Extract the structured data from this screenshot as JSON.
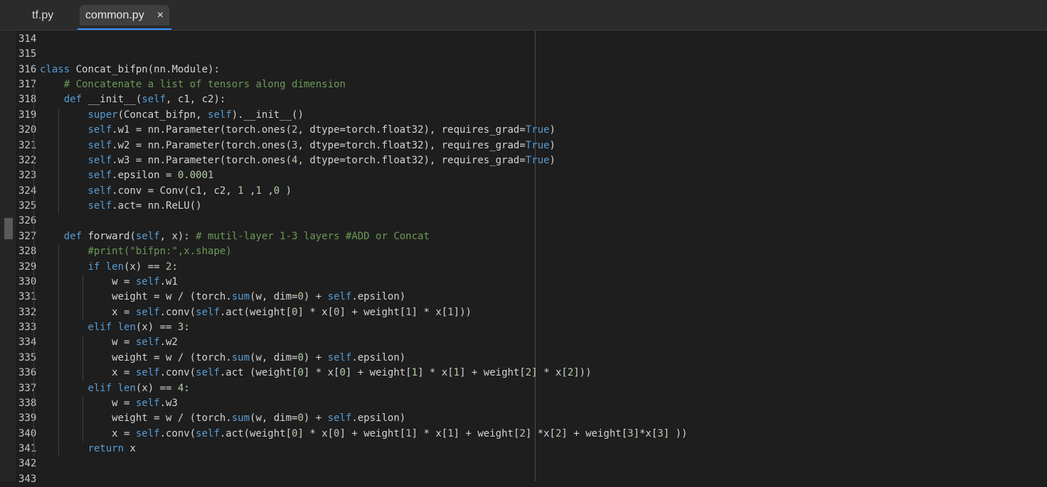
{
  "tabs": [
    {
      "label": "tf.py"
    },
    {
      "label": "common.py",
      "close_icon": "×"
    }
  ],
  "code": [
    {
      "n": "314",
      "t": ""
    },
    {
      "n": "315",
      "t": ""
    },
    {
      "n": "316",
      "t": "class Concat_bifpn(nn.Module):"
    },
    {
      "n": "317",
      "t": "    # Concatenate a list of tensors along dimension"
    },
    {
      "n": "318",
      "t": "    def __init__(self, c1, c2):"
    },
    {
      "n": "319",
      "t": "        super(Concat_bifpn, self).__init__()"
    },
    {
      "n": "320",
      "t": "        self.w1 = nn.Parameter(torch.ones(2, dtype=torch.float32), requires_grad=True)"
    },
    {
      "n": "321",
      "t": "        self.w2 = nn.Parameter(torch.ones(3, dtype=torch.float32), requires_grad=True)"
    },
    {
      "n": "322",
      "t": "        self.w3 = nn.Parameter(torch.ones(4, dtype=torch.float32), requires_grad=True)"
    },
    {
      "n": "323",
      "t": "        self.epsilon = 0.0001"
    },
    {
      "n": "324",
      "t": "        self.conv = Conv(c1, c2, 1 ,1 ,0 )"
    },
    {
      "n": "325",
      "t": "        self.act= nn.ReLU()"
    },
    {
      "n": "326",
      "t": ""
    },
    {
      "n": "327",
      "t": "    def forward(self, x): # mutil-layer 1-3 layers #ADD or Concat"
    },
    {
      "n": "328",
      "t": "        #print(\"bifpn:\",x.shape)"
    },
    {
      "n": "329",
      "t": "        if len(x) == 2:"
    },
    {
      "n": "330",
      "t": "            w = self.w1"
    },
    {
      "n": "331",
      "t": "            weight = w / (torch.sum(w, dim=0) + self.epsilon)"
    },
    {
      "n": "332",
      "t": "            x = self.conv(self.act(weight[0] * x[0] + weight[1] * x[1]))"
    },
    {
      "n": "333",
      "t": "        elif len(x) == 3:"
    },
    {
      "n": "334",
      "t": "            w = self.w2"
    },
    {
      "n": "335",
      "t": "            weight = w / (torch.sum(w, dim=0) + self.epsilon)"
    },
    {
      "n": "336",
      "t": "            x = self.conv(self.act (weight[0] * x[0] + weight[1] * x[1] + weight[2] * x[2]))"
    },
    {
      "n": "337",
      "t": "        elif len(x) == 4:"
    },
    {
      "n": "338",
      "t": "            w = self.w3"
    },
    {
      "n": "339",
      "t": "            weight = w / (torch.sum(w, dim=0) + self.epsilon)"
    },
    {
      "n": "340",
      "t": "            x = self.conv(self.act(weight[0] * x[0] + weight[1] * x[1] + weight[2] *x[2] + weight[3]*x[3] ))"
    },
    {
      "n": "341",
      "t": "        return x"
    },
    {
      "n": "342",
      "t": ""
    },
    {
      "n": "343",
      "t": ""
    }
  ],
  "colors": {
    "background": "#1e1e1e",
    "keyword": "#569cd6",
    "comment": "#6a9955",
    "number": "#b5cea8",
    "function": "#dcdcaa",
    "tab_active_underline": "#3794ff"
  }
}
